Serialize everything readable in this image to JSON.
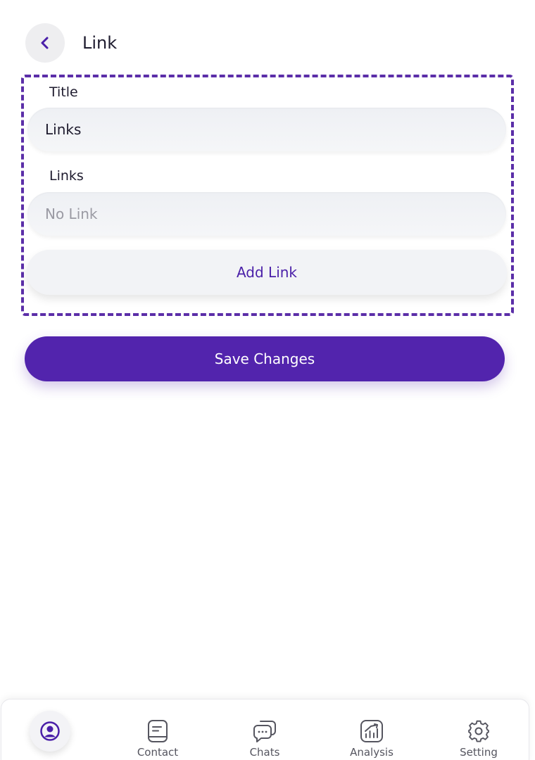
{
  "header": {
    "title": "Link"
  },
  "form": {
    "title_label": "Title",
    "title_value": "Links",
    "links_label": "Links",
    "links_placeholder": "No Link",
    "add_link_label": "Add Link"
  },
  "save_label": "Save Changes",
  "nav": {
    "profile_icon": "user-circle-icon",
    "items": [
      {
        "label": "Contact",
        "icon": "contact-book-icon"
      },
      {
        "label": "Chats",
        "icon": "chat-bubbles-icon"
      },
      {
        "label": "Analysis",
        "icon": "analysis-chart-icon"
      },
      {
        "label": "Setting",
        "icon": "gear-icon"
      }
    ]
  },
  "colors": {
    "accent": "#5224ad",
    "dashed_border": "#5b2ea8"
  }
}
